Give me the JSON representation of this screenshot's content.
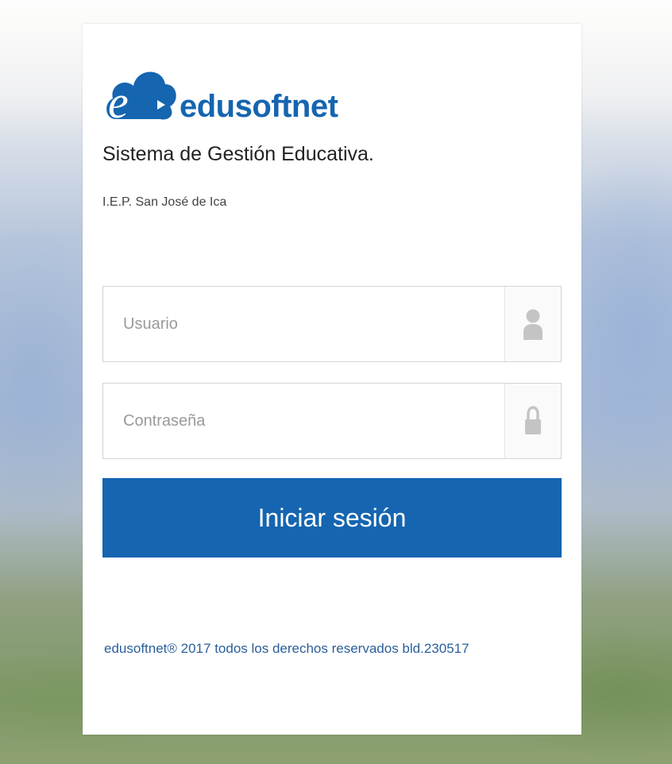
{
  "brand": {
    "name": "edusoftnet",
    "tagline": "Sistema de Gestión Educativa.",
    "institution": "I.E.P. San José de Ica"
  },
  "login_form": {
    "username_placeholder": "Usuario",
    "password_placeholder": "Contraseña",
    "username_icon": "user-icon",
    "password_icon": "lock-icon",
    "submit_label": "Iniciar sesión"
  },
  "footer": {
    "text": "edusoftnet® 2017 todos los derechos reservados bld.230517"
  },
  "colors": {
    "accent": "#1565b0",
    "footer_text": "#2a5f9a"
  }
}
